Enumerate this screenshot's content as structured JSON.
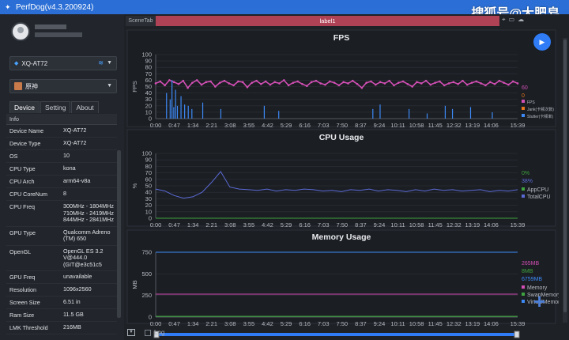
{
  "window": {
    "title": "PerfDog(v4.3.200924)",
    "watermark": "搜狐号@大肥皂"
  },
  "device_select": {
    "value": "XQ-AT72"
  },
  "app_select": {
    "value": "原神"
  },
  "tabs": [
    {
      "label": "Device"
    },
    {
      "label": "Setting"
    },
    {
      "label": "About"
    }
  ],
  "info_table": {
    "header": "Info",
    "rows": [
      {
        "key": "Device Name",
        "value": "XQ-AT72"
      },
      {
        "key": "Device Type",
        "value": "XQ-AT72"
      },
      {
        "key": "OS",
        "value": "10"
      },
      {
        "key": "CPU Type",
        "value": "kona"
      },
      {
        "key": "CPU Arch",
        "value": "arm64-v8a"
      },
      {
        "key": "CPU CoreNum",
        "value": "8"
      },
      {
        "key": "CPU Freq",
        "value": "300MHz - 1804MHz 710MHz - 2419MHz 844MHz - 2841MHz"
      },
      {
        "key": "GPU Type",
        "value": "Qualcomm Adreno (TM) 650"
      },
      {
        "key": "OpenGL",
        "value": "OpenGL ES 3.2 V@444.0 (GIT@e3c51c5"
      },
      {
        "key": "GPU Freq",
        "value": "unavailable"
      },
      {
        "key": "Resolution",
        "value": "1096x2560"
      },
      {
        "key": "Screen Size",
        "value": "6.51 in"
      },
      {
        "key": "Ram Size",
        "value": "11.5 GB"
      },
      {
        "key": "LMK Threshold",
        "value": "216MB"
      }
    ]
  },
  "topbar": {
    "scene_tab": "SceneTab",
    "label": "label1"
  },
  "footer": {
    "log_label": "Log"
  },
  "colors": {
    "accent": "#2f7cf6",
    "fps": "#d24fb5",
    "jank": "#e8761c",
    "stutter": "#3d8af7",
    "cpu": "#5b6bd6",
    "label_bar": "#b04255"
  },
  "chart_data": [
    {
      "type": "line",
      "title": "FPS",
      "ylabel": "FPS",
      "ylim": [
        0,
        100
      ],
      "yticks": [
        0,
        10,
        20,
        30,
        40,
        50,
        60,
        70,
        80,
        90,
        100
      ],
      "xticks": [
        "0:00",
        "0:47",
        "1:34",
        "2:21",
        "3:08",
        "3:55",
        "4:42",
        "5:29",
        "6:16",
        "7:03",
        "7:50",
        "8:37",
        "9:24",
        "10:11",
        "10:58",
        "11:45",
        "12:32",
        "13:19",
        "14:06",
        "15:39"
      ],
      "legend_values": [
        "60",
        "0"
      ],
      "series": [
        {
          "name": "FPS",
          "color": "#d24fb5",
          "values": [
            55,
            58,
            52,
            60,
            57,
            54,
            59,
            48,
            56,
            60,
            53,
            57,
            58,
            50,
            56,
            59,
            55,
            52,
            58,
            57,
            49,
            56,
            59,
            54,
            58,
            53,
            57,
            55,
            60,
            52,
            56,
            58,
            54,
            51,
            57,
            59,
            55,
            53,
            58,
            56,
            52,
            57,
            55,
            59,
            54,
            48,
            56,
            58,
            53,
            57,
            55,
            59,
            52,
            56,
            58,
            54,
            50,
            57,
            55,
            59,
            53,
            56,
            58,
            52,
            55,
            57,
            54,
            59,
            53,
            56,
            58,
            55,
            52,
            57,
            54,
            59,
            56,
            53,
            58,
            55
          ]
        },
        {
          "name": "Jank(卡顿次数)",
          "color": "#e8761c",
          "values": []
        },
        {
          "name": "Stutter(卡顿率)",
          "color": "#3d8af7",
          "values": []
        }
      ]
    },
    {
      "type": "line",
      "title": "CPU Usage",
      "ylabel": "%",
      "ylim": [
        0,
        100
      ],
      "yticks": [
        0,
        10,
        20,
        30,
        40,
        50,
        60,
        70,
        80,
        90,
        100
      ],
      "xticks": [
        "0:00",
        "0:47",
        "1:34",
        "2:21",
        "3:08",
        "3:55",
        "4:42",
        "5:29",
        "6:16",
        "7:03",
        "7:50",
        "8:37",
        "9:24",
        "10:11",
        "10:58",
        "11:45",
        "12:32",
        "13:19",
        "14:06",
        "15:39"
      ],
      "legend_values": [
        "0%",
        "38%"
      ],
      "series": [
        {
          "name": "AppCPU",
          "color": "#3fa33f",
          "values": [
            0,
            0,
            0,
            0,
            0,
            0,
            0,
            0,
            0,
            0,
            0,
            0,
            0,
            0,
            0,
            0,
            0,
            0,
            0,
            0
          ]
        },
        {
          "name": "TotalCPU",
          "color": "#5b6bd6",
          "values": [
            45,
            42,
            35,
            31,
            33,
            40,
            55,
            72,
            48,
            45,
            44,
            43,
            45,
            42,
            44,
            43,
            45,
            44,
            42,
            43,
            41,
            44,
            43,
            45,
            42,
            44,
            43,
            41,
            44,
            42,
            45,
            43,
            44,
            42,
            43,
            44,
            41,
            43,
            42,
            44
          ]
        }
      ]
    },
    {
      "type": "line",
      "title": "Memory Usage",
      "ylabel": "MB",
      "ylim": [
        0,
        750
      ],
      "yticks": [
        0,
        250,
        500,
        750
      ],
      "xticks": [
        "0:00",
        "0:47",
        "1:34",
        "2:21",
        "3:08",
        "3:55",
        "4:42",
        "5:29",
        "6:16",
        "7:03",
        "7:50",
        "8:37",
        "9:24",
        "10:11",
        "10:58",
        "11:45",
        "12:32",
        "13:19",
        "14:06",
        "15:39"
      ],
      "legend_values": [
        "265MB",
        "8MB",
        "6759MB"
      ],
      "series": [
        {
          "name": "Memory",
          "color": "#d24fb5",
          "values": [
            265,
            265
          ]
        },
        {
          "name": "SwapMemory",
          "color": "#3fa33f",
          "values": [
            8,
            8
          ]
        },
        {
          "name": "VirtualMemory",
          "color": "#3d8af7",
          "values": [
            6759,
            6759
          ]
        }
      ]
    }
  ]
}
